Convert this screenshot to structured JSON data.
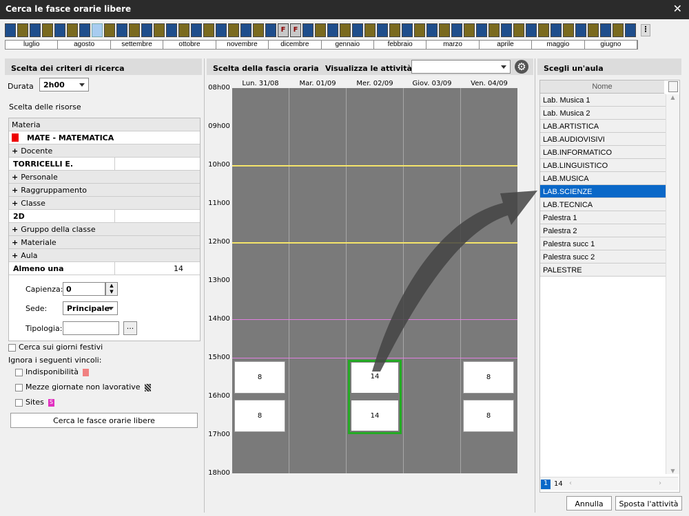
{
  "window": {
    "title": "Cerca le fasce orarie libere",
    "close": "✕"
  },
  "weeks": {
    "pattern": [
      "b",
      "o",
      "b",
      "o",
      "b",
      "o",
      "b",
      "l",
      "o",
      "b",
      "o",
      "b",
      "o",
      "b",
      "o",
      "b",
      "o",
      "b",
      "o",
      "b",
      "o",
      "b",
      "F",
      "F",
      "b",
      "o",
      "b",
      "o",
      "b",
      "o",
      "b",
      "o",
      "b",
      "o",
      "b",
      "o",
      "b",
      "o",
      "b",
      "o",
      "b",
      "o",
      "b",
      "o",
      "b",
      "o",
      "b",
      "o",
      "b",
      "o",
      "b",
      "F",
      "b",
      "o",
      "b",
      "o",
      "b",
      "o",
      "b",
      "o",
      "b",
      "o",
      "b",
      "o",
      "b",
      "o",
      "b",
      "o",
      "b",
      "o",
      "b",
      "o",
      "b",
      "o",
      "b",
      "o",
      "b",
      "o",
      "b",
      "o",
      "b",
      "o",
      "b",
      "o",
      "b",
      "o",
      "b",
      "o",
      "b"
    ],
    "more": "⋮"
  },
  "months": [
    "luglio",
    "agosto",
    "settembre",
    "ottobre",
    "novembre",
    "dicembre",
    "gennaio",
    "febbraio",
    "marzo",
    "aprile",
    "maggio",
    "giugno"
  ],
  "left": {
    "header": "Scelta dei criteri di ricerca",
    "durata_label": "Durata",
    "durata_value": "2h00",
    "risorse_label": "Scelta delle risorse",
    "materia_header": "Materia",
    "materia_value": "MATE - MATEMATICA",
    "docente": "Docente",
    "docente_value": "TORRICELLI E.",
    "personale": "Personale",
    "raggruppamento": "Raggruppamento",
    "classe": "Classe",
    "classe_value": "2D",
    "gruppo": "Gruppo della classe",
    "materiale": "Materiale",
    "aula": "Aula",
    "almeno_label": "Almeno una",
    "almeno_count": "14",
    "capienza_label": "Capienza:",
    "capienza_value": "0",
    "sede_label": "Sede:",
    "sede_value": "Principale",
    "tipologia_label": "Tipologia:",
    "tipologia_btn": "...",
    "festivi": "Cerca sui giorni festivi",
    "ignora": "Ignora i seguenti vincoli:",
    "indisp": "Indisponibilità",
    "mezze": "Mezze giornate non lavorative",
    "sites": "Sites",
    "sites_badge": "S",
    "search_btn": "Cerca le fasce orarie libere"
  },
  "mid": {
    "header": "Scelta della fascia oraria",
    "visualizza": "Visualizza le attività di",
    "days": [
      "Lun. 31/08",
      "Mar. 01/09",
      "Mer. 02/09",
      "Giov. 03/09",
      "Ven. 04/09"
    ],
    "hours": [
      "08h00",
      "09h00",
      "10h00",
      "11h00",
      "12h00",
      "13h00",
      "14h00",
      "15h00",
      "16h00",
      "17h00",
      "18h00"
    ],
    "cells": [
      "8",
      "8",
      "14",
      "14",
      "8",
      "8"
    ]
  },
  "right": {
    "header": "Scegli un'aula",
    "col_header": "Nome",
    "rooms": [
      "Lab. Musica 1",
      "Lab. Musica 2",
      "LAB.ARTISTICA",
      "LAB.AUDIOVISIVI",
      "LAB.INFORMATICO",
      "LAB.LINGUISTICO",
      "LAB.MUSICA",
      "LAB.SCIENZE",
      "LAB.TECNICA",
      "Palestra 1",
      "Palestra 2",
      "Palestra succ 1",
      "Palestra succ 2",
      "PALESTRE"
    ],
    "selected": "LAB.SCIENZE",
    "page_current": "1",
    "page_total": "14"
  },
  "footer": {
    "cancel": "Annulla",
    "move": "Sposta l'attività"
  },
  "colors": {
    "accent": "#0a68c8",
    "green": "#22aa22",
    "yellow": "#f5e56a",
    "pink": "#e080e0"
  }
}
